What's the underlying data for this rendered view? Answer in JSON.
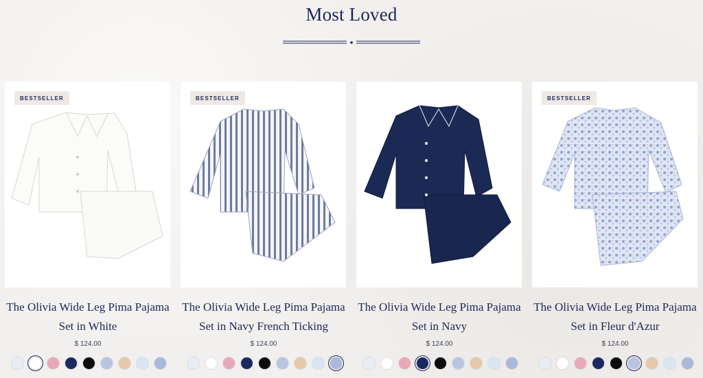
{
  "section": {
    "title": "Most Loved"
  },
  "products": [
    {
      "badge": "BESTSELLER",
      "title_line1": "The Olivia Wide Leg Pima Pajama",
      "title_line2": "Set in White",
      "price": "$ 124.00",
      "color": "white"
    },
    {
      "badge": "BESTSELLER",
      "title_line1": "The Olivia Wide Leg Pima Pajama",
      "title_line2": "Set in Navy French Ticking",
      "price": "$ 124.00",
      "color": "navy-stripe"
    },
    {
      "badge": "",
      "title_line1": "The Olivia Wide Leg Pima Pajama",
      "title_line2": "Set in Navy",
      "price": "$ 124.00",
      "color": "navy"
    },
    {
      "badge": "BESTSELLER",
      "title_line1": "The Olivia Wide Leg Pima Pajama",
      "title_line2": "Set in Fleur d'Azur",
      "price": "$ 124.00",
      "color": "floral"
    }
  ],
  "swatch_colors": [
    "#e9ecf4",
    "#ffffff",
    "#e9a8b8",
    "#1b2a5e",
    "#0d0d0d",
    "#b9c4e0",
    "#e8c8a8",
    "#dbe6f4",
    "#aab8dc"
  ],
  "selected_swatch": [
    1,
    8,
    3,
    5
  ]
}
